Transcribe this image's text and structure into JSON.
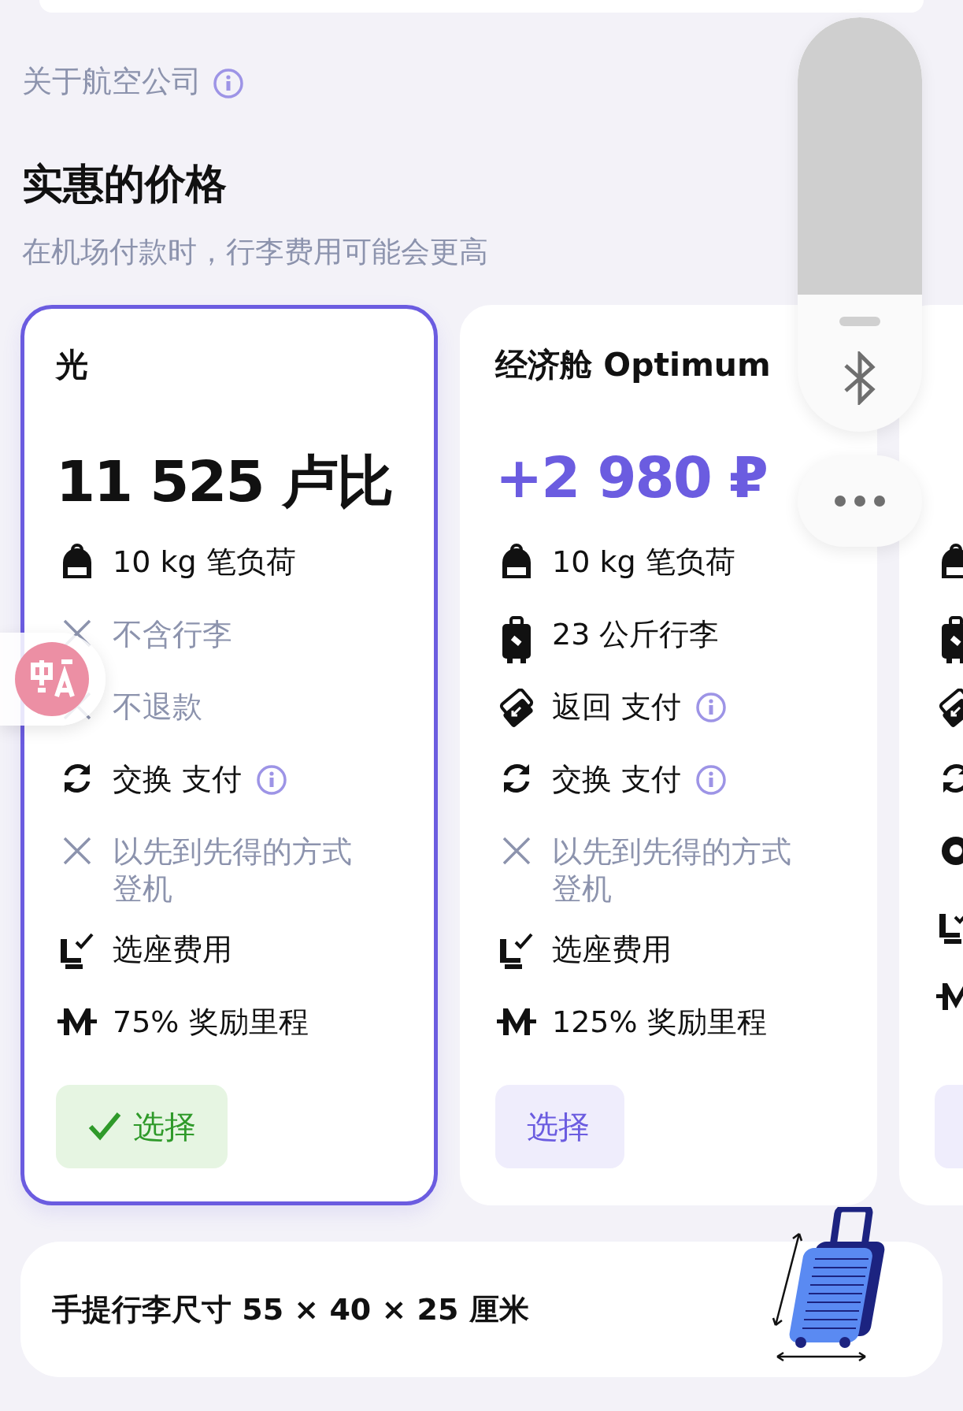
{
  "about_link": {
    "label": "关于航空公司"
  },
  "section": {
    "title": "实惠的价格",
    "subtitle": "在机场付款时，行李费用可能会更高"
  },
  "fares": [
    {
      "title": "光",
      "price": "11 525 卢比",
      "kind": "total",
      "selected": true,
      "button": "选择",
      "features": [
        {
          "kind": "backpack",
          "text": "10 kg 笔负荷",
          "included": true,
          "info": false
        },
        {
          "kind": "cross",
          "text": "不含行李",
          "included": false,
          "info": false
        },
        {
          "kind": "cross",
          "text": "不退款",
          "included": false,
          "info": false
        },
        {
          "kind": "exchange",
          "text": "交换 支付",
          "included": true,
          "info": true
        },
        {
          "kind": "cross",
          "text": "以先到先得的方式登机",
          "included": false,
          "info": false
        },
        {
          "kind": "seat",
          "text": "选座费用",
          "included": true,
          "info": false
        },
        {
          "kind": "miles",
          "text": "75% 奖励里程",
          "included": true,
          "info": false
        }
      ]
    },
    {
      "title": "经济舱 Optimum",
      "price": "+2 980 ₽",
      "kind": "extra",
      "selected": false,
      "button": "选择",
      "features": [
        {
          "kind": "backpack",
          "text": "10 kg 笔负荷",
          "included": true,
          "info": false
        },
        {
          "kind": "suitcase",
          "text": "23 公斤行李",
          "included": true,
          "info": false
        },
        {
          "kind": "refund",
          "text": "返回 支付",
          "included": true,
          "info": true
        },
        {
          "kind": "exchange",
          "text": "交换 支付",
          "included": true,
          "info": true
        },
        {
          "kind": "cross",
          "text": "以先到先得的方式登机",
          "included": false,
          "info": false
        },
        {
          "kind": "seat",
          "text": "选座费用",
          "included": true,
          "info": false
        },
        {
          "kind": "miles",
          "text": "125% 奖励里程",
          "included": true,
          "info": false
        }
      ]
    },
    {
      "selected": false,
      "features": [
        {
          "kind": "backpack"
        },
        {
          "kind": "suitcase"
        },
        {
          "kind": "refund"
        },
        {
          "kind": "exchange"
        },
        {
          "kind": "badge"
        },
        {
          "kind": "seat"
        },
        {
          "kind": "miles"
        }
      ]
    }
  ],
  "hand_luggage": {
    "text": "手提行李尺寸 55 × 40 × 25 厘米"
  }
}
